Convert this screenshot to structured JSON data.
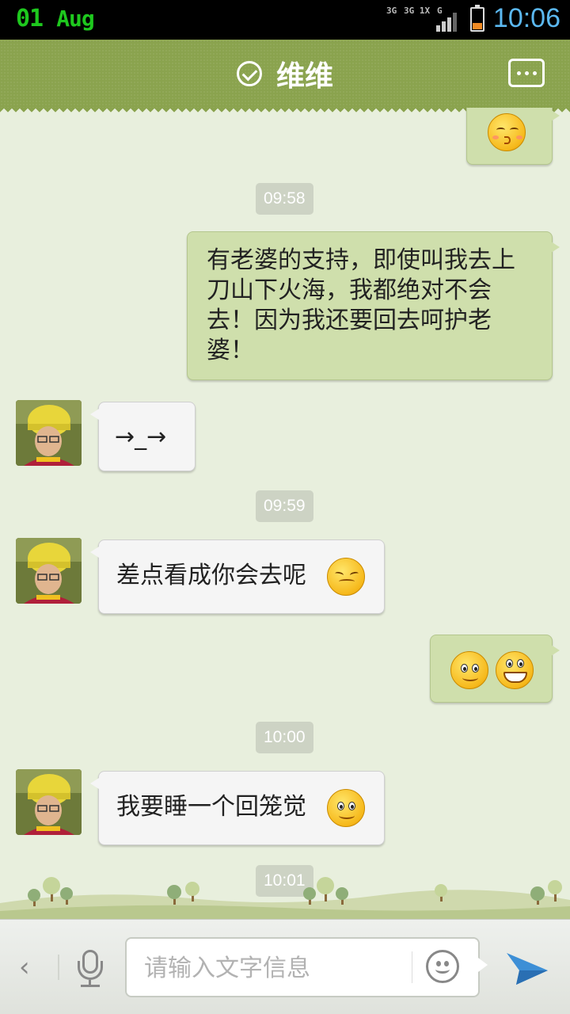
{
  "status_bar": {
    "date_day": "01",
    "date_month": "Aug",
    "net_label_1": "3G",
    "net_label_2": "3G 1X",
    "net_label_3": "G",
    "time": "10:06"
  },
  "header": {
    "title": "维维"
  },
  "messages": {
    "ts_1": "09:58",
    "out_text_1": "有老婆的支持，即使叫我去上刀山下火海，我都绝对不会去！因为我还要回去呵护老婆！",
    "in_text_1": "→_→",
    "ts_2": "09:59",
    "in_text_2": "差点看成你会去呢",
    "ts_3": "10:00",
    "in_text_3": "我要睡一个回笼觉",
    "ts_4": "10:01"
  },
  "input_bar": {
    "placeholder": "请输入文字信息"
  },
  "colors": {
    "header_green": "#8aa34e",
    "outgoing_bubble": "#cfdfac",
    "incoming_bubble": "#f5f5f5",
    "time_blue": "#5bb8f0",
    "send_blue": "#3d8fd6"
  },
  "icons": [
    "verified-check-icon",
    "more-options-icon",
    "back-arrow-icon",
    "microphone-icon",
    "emoji-icon",
    "send-icon",
    "battery-icon",
    "signal-icon"
  ]
}
